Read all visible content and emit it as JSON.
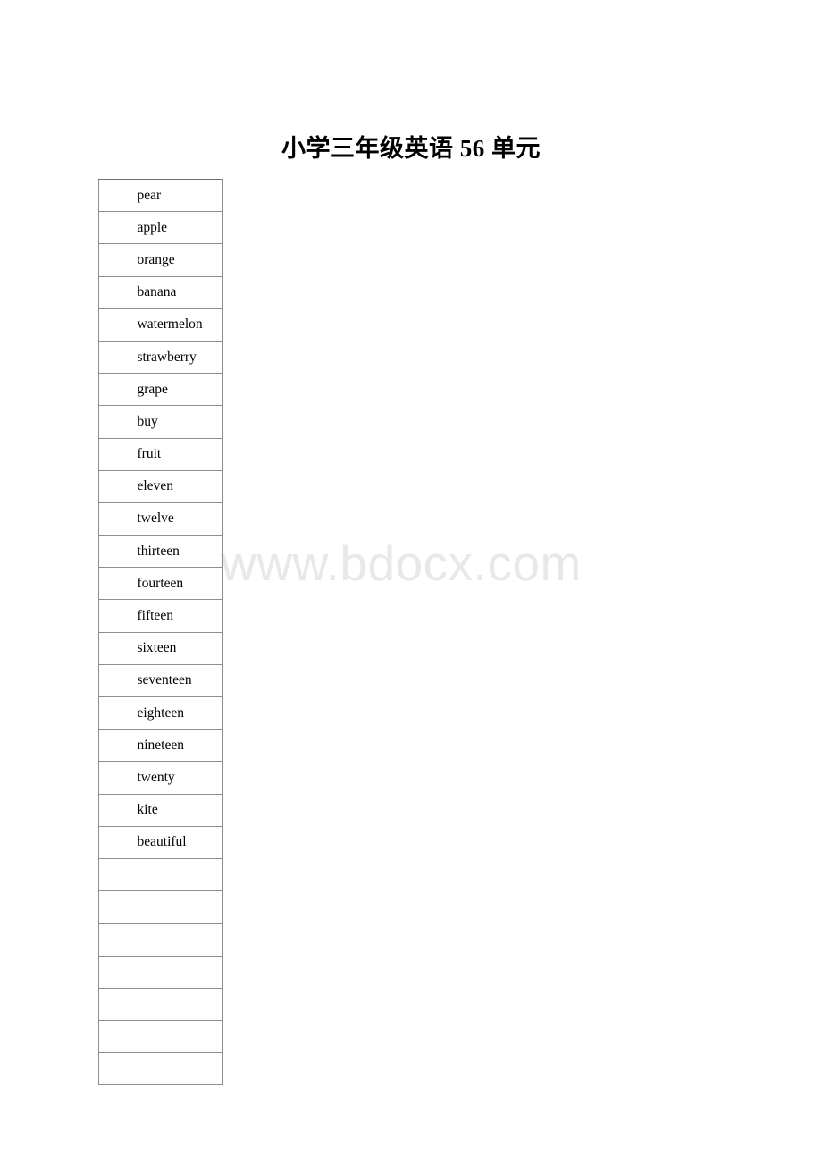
{
  "document": {
    "title": "小学三年级英语 56 单元",
    "watermark": "www.bdocx.com",
    "background_color": "#ffffff",
    "text_color": "#000000",
    "watermark_color": "#e8e8e8",
    "table_border_color": "#8d8d8d"
  },
  "vocab_table": {
    "column_count": 1,
    "row_count": 28,
    "filled_row_count": 21,
    "empty_row_count": 7,
    "rows": [
      {
        "word": "pear"
      },
      {
        "word": "apple"
      },
      {
        "word": "orange"
      },
      {
        "word": "banana"
      },
      {
        "word": "watermelon"
      },
      {
        "word": "strawberry"
      },
      {
        "word": "grape"
      },
      {
        "word": "buy"
      },
      {
        "word": "fruit"
      },
      {
        "word": "eleven"
      },
      {
        "word": "twelve"
      },
      {
        "word": "thirteen"
      },
      {
        "word": "fourteen"
      },
      {
        "word": "fifteen"
      },
      {
        "word": "sixteen"
      },
      {
        "word": "seventeen"
      },
      {
        "word": "eighteen"
      },
      {
        "word": "nineteen"
      },
      {
        "word": "twenty"
      },
      {
        "word": "kite"
      },
      {
        "word": "beautiful"
      },
      {
        "word": ""
      },
      {
        "word": ""
      },
      {
        "word": ""
      },
      {
        "word": ""
      },
      {
        "word": ""
      },
      {
        "word": ""
      },
      {
        "word": ""
      }
    ]
  }
}
